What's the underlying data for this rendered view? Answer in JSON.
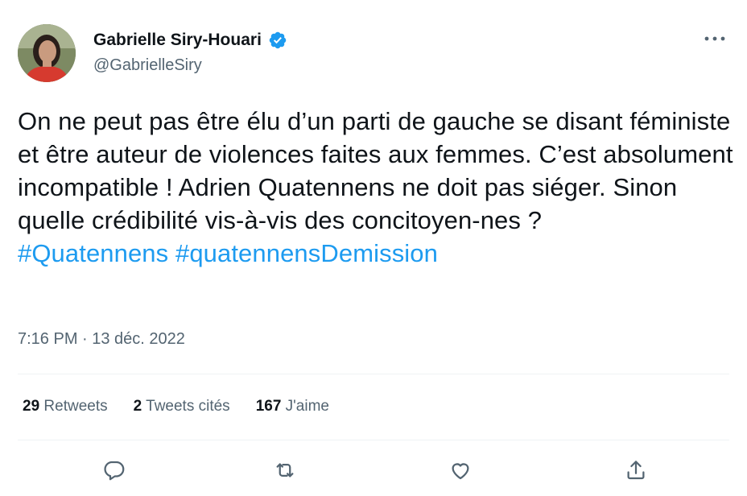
{
  "author": {
    "name": "Gabrielle Siry-Houari",
    "handle": "@GabrielleSiry",
    "verified_color": "#1d9bf0"
  },
  "tweet": {
    "text": "On ne peut pas être élu d’un parti de gauche se disant féministe et être auteur de violences faites aux femmes. C’est absolument incompatible ! Adrien Quatennens ne doit pas siéger. Sinon quelle crédibilité vis-à-vis des concitoyen-nes ?",
    "hashtags": [
      "#Quatennens",
      "#quatennensDemission"
    ],
    "timestamp": "7:16 PM · 13 déc. 2022"
  },
  "stats": {
    "retweets_count": "29",
    "retweets_label": "Retweets",
    "quotes_count": "2",
    "quotes_label": "Tweets cités",
    "likes_count": "167",
    "likes_label": "J'aime"
  },
  "actions": {
    "reply_icon": "reply-icon",
    "retweet_icon": "retweet-icon",
    "like_icon": "heart-icon",
    "share_icon": "share-icon"
  },
  "colors": {
    "text": "#0f1419",
    "secondary": "#536471",
    "accent": "#1d9bf0",
    "divider": "#eff3f4"
  }
}
